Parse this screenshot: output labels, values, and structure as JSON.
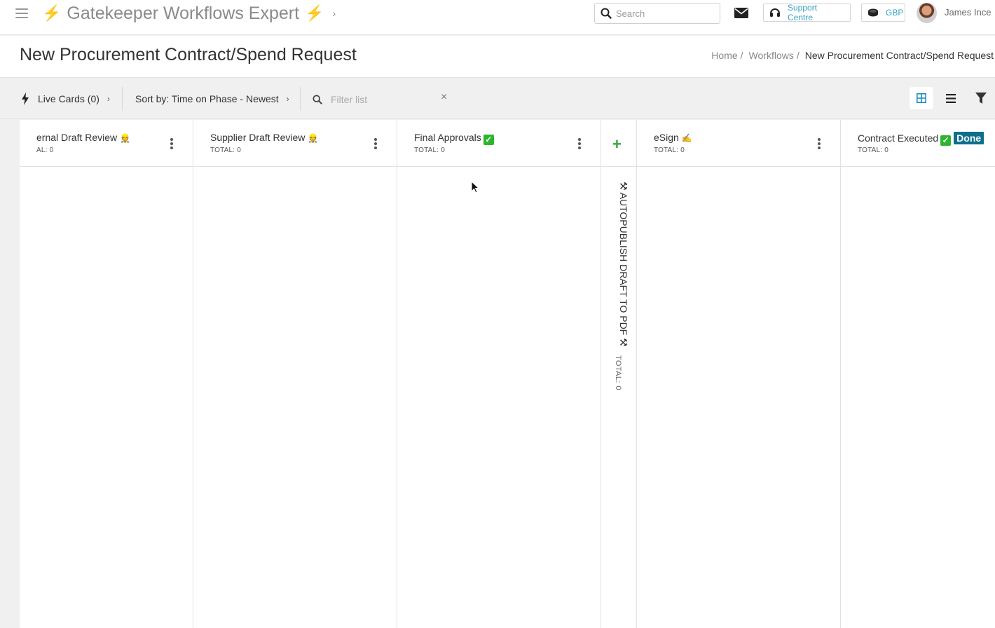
{
  "topbar": {
    "app_title": "Gatekeeper Workflows Expert",
    "search_placeholder": "Search",
    "support_label": "Support Centre",
    "currency_label": "GBP",
    "user_name": "James Ince",
    "accent_color": "#37a3c6",
    "bolt_color": "#f0b400"
  },
  "page": {
    "title": "New Procurement Contract/Spend Request",
    "breadcrumb": [
      "Home",
      "Workflows",
      "New Procurement Contract/Spend Request"
    ],
    "breadcrumb_sep": "/"
  },
  "toolbar": {
    "live_cards_label": "Live Cards (0)",
    "sort_label": "Sort by: Time on Phase - Newest",
    "filter_placeholder": "Filter list",
    "clear_symbol": "×"
  },
  "board": {
    "columns": [
      {
        "name": "ernal Draft Review",
        "emoji": "👷",
        "total_label": "AL: 0"
      },
      {
        "name": "Supplier Draft Review",
        "emoji": "👷",
        "total_label": "TOTAL: 0"
      },
      {
        "name": "Final Approvals",
        "total_label": "TOTAL: 0"
      },
      {
        "name": "⚒ AUTOPUBLISH DRAFT TO PDF ⚒",
        "total_label": "TOTAL: 0",
        "add_symbol": "+"
      },
      {
        "name": "eSign",
        "emoji": "✍",
        "total_label": "TOTAL: 0"
      },
      {
        "name": "Contract Executed",
        "total_label": "TOTAL: 0",
        "badge": "Done"
      }
    ],
    "done_badge_color": "#0e6e8c",
    "check_color": "#2db52d"
  }
}
